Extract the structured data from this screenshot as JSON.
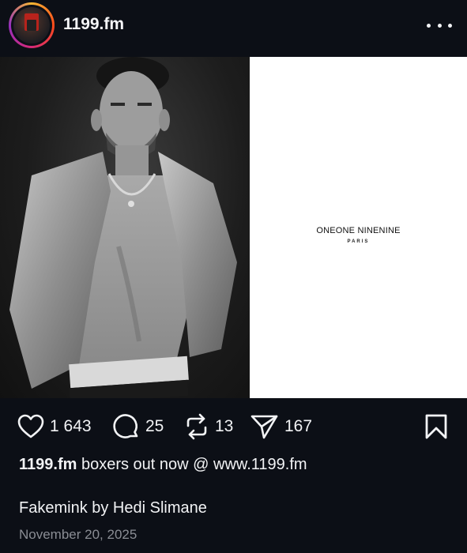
{
  "header": {
    "username": "1199.fm",
    "avatar_icon": "profile-avatar",
    "more_icon": "more-horizontal-icon"
  },
  "media": {
    "right_panel": {
      "brand": "ONEONE NINENINE",
      "sub": "PARIS"
    }
  },
  "actions": {
    "likes": "1 643",
    "comments": "25",
    "reposts": "13",
    "shares": "167"
  },
  "caption": {
    "username": "1199.fm",
    "text": "boxers out now @ www.1199.fm",
    "second_line": "Fakemink by Hedi Slimane",
    "date": "November 20, 2025"
  },
  "colors": {
    "background": "#0c0f16",
    "text": "#f2f3f5",
    "muted": "#8a8d94"
  }
}
